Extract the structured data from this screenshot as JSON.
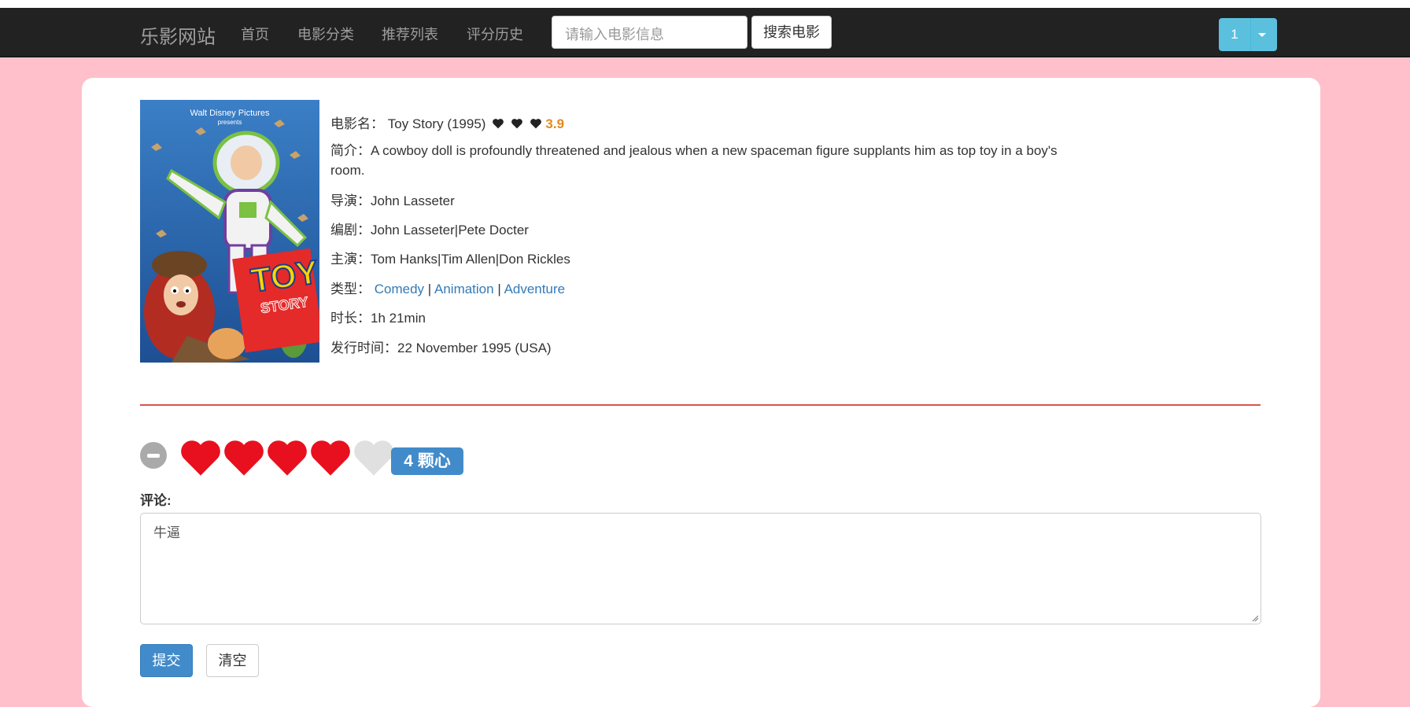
{
  "navbar": {
    "brand": "乐影网站",
    "links": [
      "首页",
      "电影分类",
      "推荐列表",
      "评分历史"
    ],
    "search_placeholder": "请输入电影信息",
    "search_button": "搜索电影",
    "user_label": "1"
  },
  "movie": {
    "name_label": "电影名：",
    "name": "Toy Story (1995)",
    "avg_score": "3.9",
    "summary_label": "简介：",
    "summary": "A cowboy doll is profoundly threatened and jealous when a new spaceman figure supplants him as top toy in a boy's room.",
    "director_label": "导演：",
    "director": "John Lasseter",
    "writer_label": "编剧：",
    "writer": "John Lasseter|Pete Docter",
    "cast_label": "主演：",
    "cast": "Tom Hanks|Tim Allen|Don Rickles",
    "genre_label": "类型：",
    "genres": [
      "Comedy",
      "Animation",
      "Adventure"
    ],
    "genre_sep": "|",
    "duration_label": "时长：",
    "duration": "1h 21min",
    "release_label": "发行时间：",
    "release": "22 November 1995 (USA)",
    "poster": {
      "studio_line1": "Walt Disney Pictures",
      "studio_line2": "presents",
      "title_line1": "TOY",
      "title_line2": "STORY"
    }
  },
  "rating": {
    "value": 4,
    "max": 5,
    "badge": "4 颗心",
    "filled_color": "#e8101e",
    "empty_color": "#e0e0e0"
  },
  "comment": {
    "label": "评论:",
    "text": "牛逼"
  },
  "actions": {
    "submit": "提交",
    "clear": "清空"
  },
  "colors": {
    "page_bg": "#ffc0cb",
    "navbar_bg": "#222222",
    "divider": "#d9534f",
    "primary": "#428bca",
    "info": "#5bc0de",
    "score": "#e08a1e"
  }
}
